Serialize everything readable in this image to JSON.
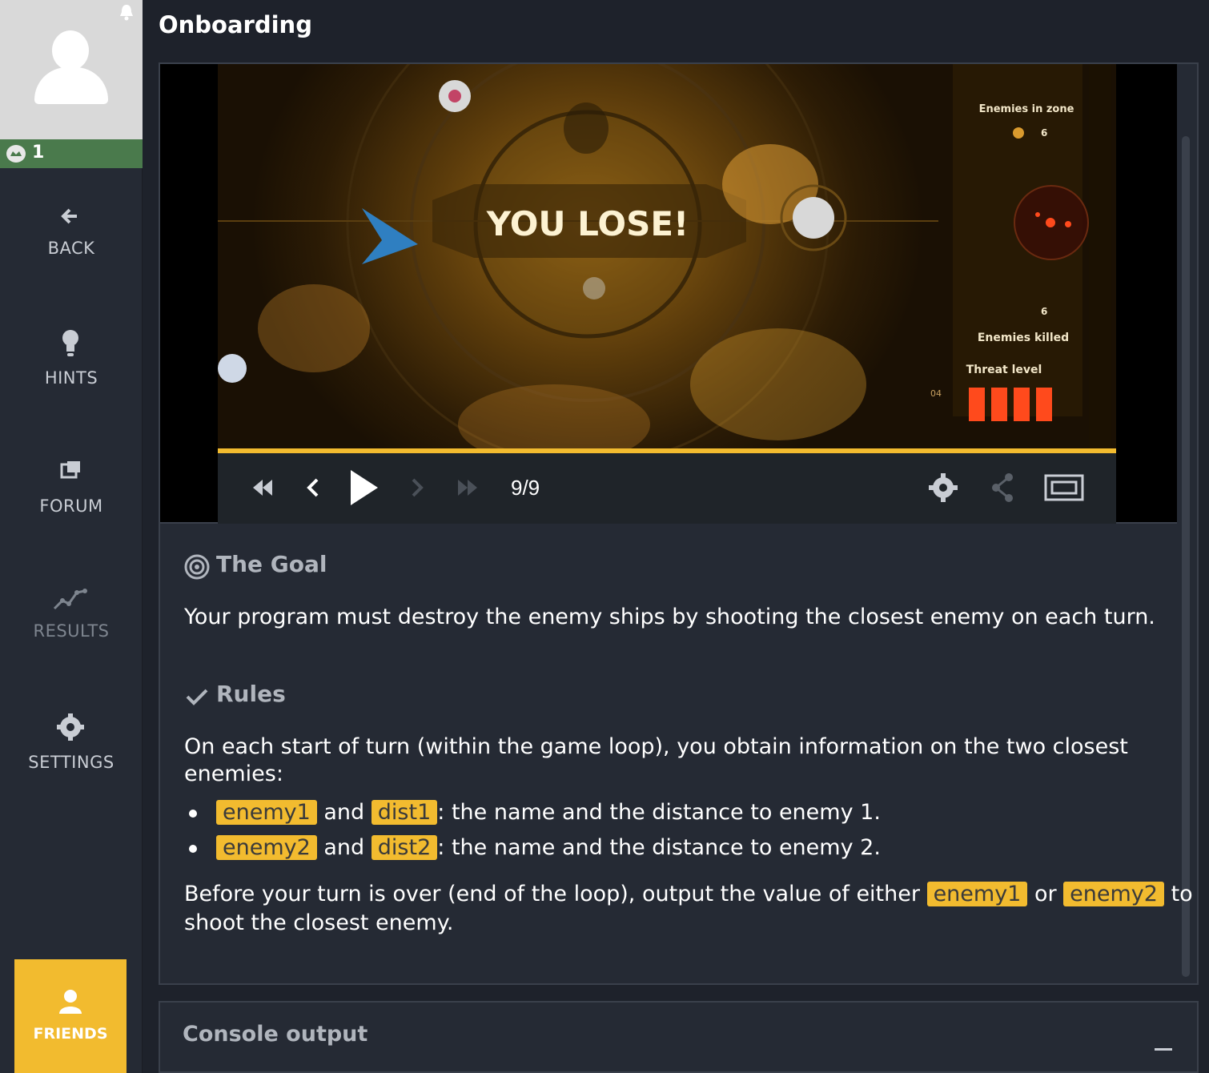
{
  "sidebar": {
    "level": "1",
    "items": [
      {
        "label": "BACK"
      },
      {
        "label": "HINTS"
      },
      {
        "label": "FORUM"
      },
      {
        "label": "RESULTS"
      },
      {
        "label": "SETTINGS"
      }
    ],
    "friends_label": "FRIENDS"
  },
  "header": {
    "title": "Onboarding"
  },
  "viewer": {
    "overlay_text": "YOU LOSE!",
    "frame": "9/9",
    "progress": 1.0,
    "hud": {
      "enemies_in_zone_label": "Enemies in zone",
      "enemies_in_zone_value": "6",
      "enemies_killed_label": "Enemies killed",
      "enemies_killed_value": "6",
      "threat_label": "Threat level",
      "threat_value": "04"
    }
  },
  "goal": {
    "heading": "The Goal",
    "text": "Your program must destroy the enemy ships by shooting the closest enemy on each turn."
  },
  "rules": {
    "heading": "Rules",
    "intro": "On each start of turn (within the game loop), you obtain information on the two closest enemies:",
    "items": [
      {
        "var1": "enemy1",
        "and": "and",
        "var2": "dist1",
        "desc": ": the name and the distance to enemy 1."
      },
      {
        "var1": "enemy2",
        "and": "and",
        "var2": "dist2",
        "desc": ": the name and the distance to enemy 2."
      }
    ],
    "outro_a": "Before your turn is over (end of the loop), output the value of either",
    "outro_var1": "enemy1",
    "outro_or": "or",
    "outro_var2": "enemy2",
    "outro_b": "to",
    "outro_c": "shoot the closest enemy."
  },
  "console": {
    "heading": "Console output"
  },
  "colors": {
    "accent": "#f2bb2f",
    "level_bar": "#4a7a4c",
    "panel": "#252a34",
    "threat": "#ff4a1c"
  }
}
